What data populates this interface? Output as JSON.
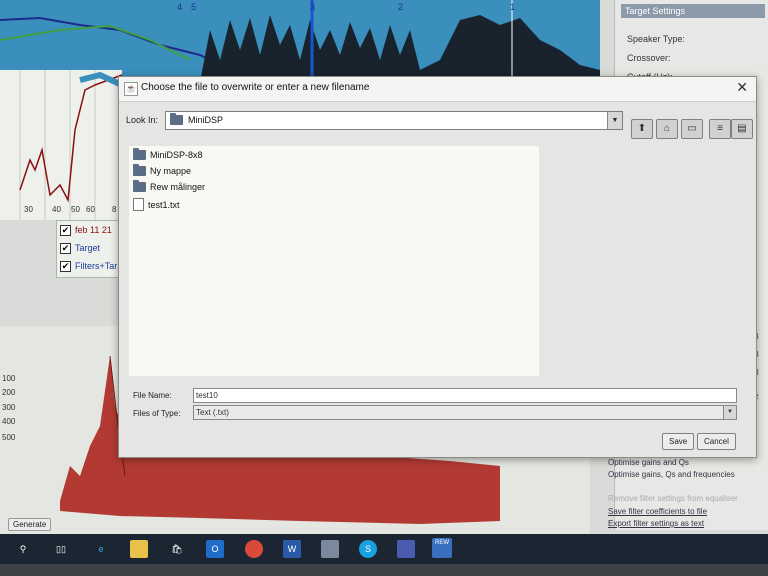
{
  "background_app": {
    "graph_markers": [
      "4",
      "5",
      "3",
      "2",
      "1"
    ],
    "freq_axis_ticks": [
      "30",
      "40",
      "50",
      "60",
      "8"
    ],
    "legend": [
      {
        "label": "feb 11 21",
        "checked": true
      },
      {
        "label": "Target",
        "checked": true
      },
      {
        "label": "Filters+Tar",
        "checked": true
      }
    ],
    "right_panel": {
      "title": "Target Settings",
      "labels": [
        "Speaker Type:",
        "Crossover:",
        "Cutoff (Hz):"
      ],
      "units": [
        "dB",
        "dB",
        "dB",
        "Hz"
      ],
      "links": [
        "Optimise gains and Qs",
        "Optimise gains, Qs and frequencies",
        "Remove filter settings from equaliser",
        "Save filter coefficients to file",
        "Export filter settings as text"
      ]
    },
    "bottom_ticks": [
      "100",
      "200",
      "300",
      "400",
      "500"
    ],
    "generate_label": "Generate"
  },
  "dialog": {
    "title": "Choose the file to overwrite or enter a new filename",
    "look_in_label": "Look In:",
    "look_in_value": "MiniDSP",
    "files": [
      {
        "name": "MiniDSP-8x8",
        "type": "folder"
      },
      {
        "name": "Ny mappe",
        "type": "folder"
      },
      {
        "name": "Rew målinger",
        "type": "folder"
      },
      {
        "name": "test1.txt",
        "type": "file"
      }
    ],
    "file_name_label": "File Name:",
    "file_name_value": "test10",
    "file_type_label": "Files of Type:",
    "file_type_value": "Text (.txt)",
    "save_label": "Save",
    "cancel_label": "Cancel"
  },
  "taskbar": {
    "items": [
      "search-icon",
      "task-view-icon",
      "edge-icon",
      "file-explorer-icon",
      "store-icon",
      "outlook-icon",
      "chrome-icon",
      "word-icon",
      "app-icon",
      "skype-icon",
      "teams-icon",
      "rew-icon"
    ],
    "rew_label": "REW"
  }
}
